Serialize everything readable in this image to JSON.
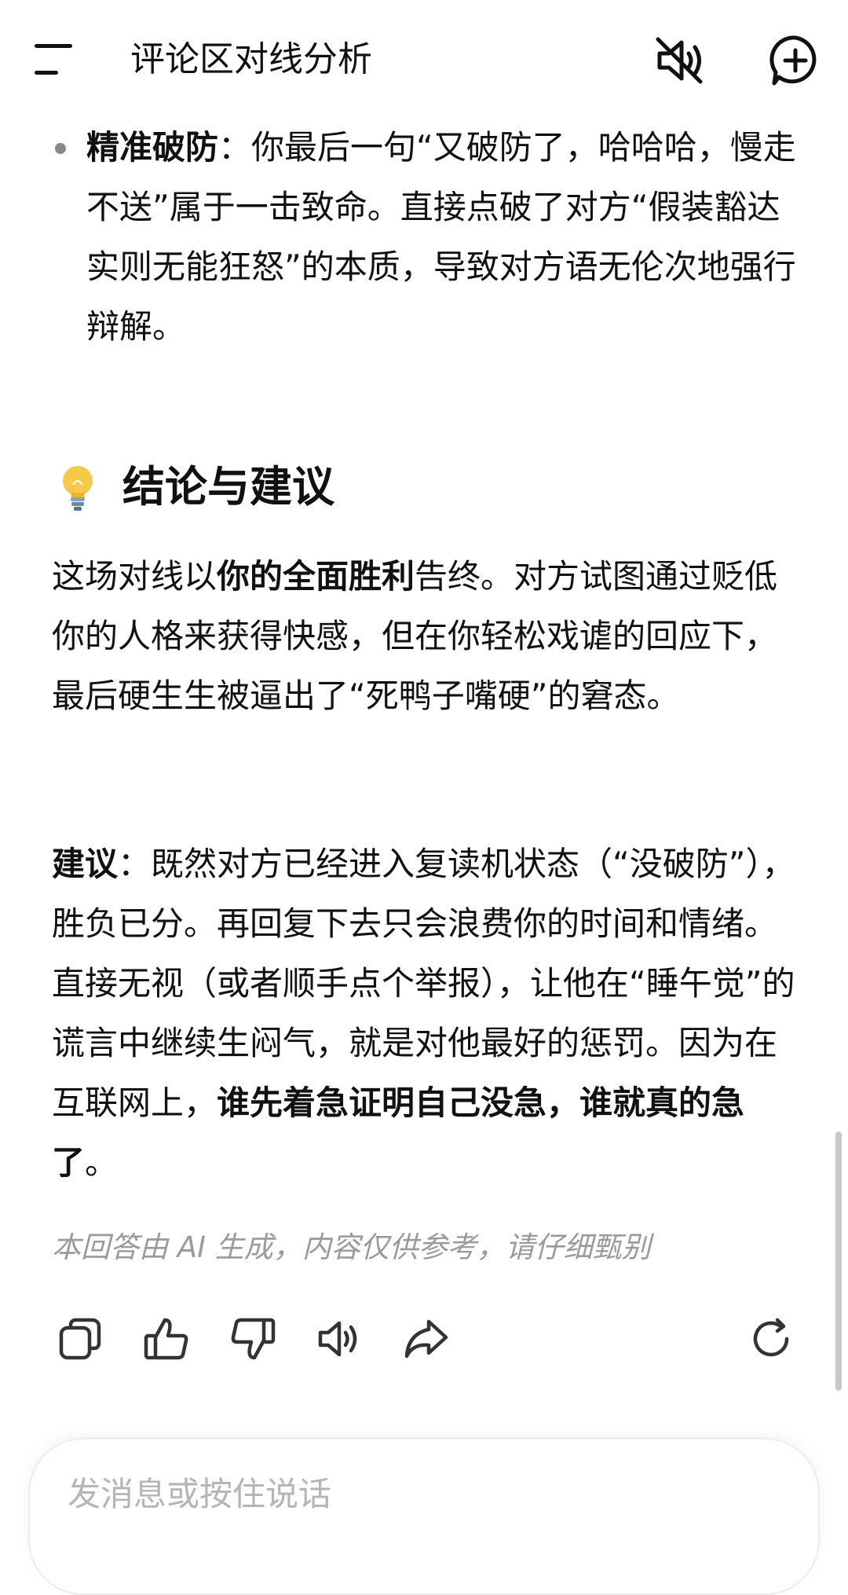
{
  "header": {
    "title": "评论区对线分析"
  },
  "bullet": {
    "bold": "精准破防",
    "text": "：你最后一句“又破防了，哈哈哈，慢走不送”属于一击致命。直接点破了对方“假装豁达实则无能狂怒”的本质，导致对方语无伦次地强行辩解。"
  },
  "section": {
    "title": "结论与建议"
  },
  "para1": {
    "pre": "这场对线以",
    "bold": "你的全面胜利",
    "post": "告终。对方试图通过贬低你的人格来获得快感，但在你轻松戏谑的回应下，最后硬生生被逼出了“死鸭子嘴硬”的窘态。"
  },
  "para2": {
    "bold_lead": "建议",
    "text": "：既然对方已经进入复读机状态（“没破防”），胜负已分。再回复下去只会浪费你的时间和情绪。直接无视（或者顺手点个举报），让他在“睡午觉”的谎言中继续生闷气，就是对他最好的惩罚。因为在互联网上，",
    "bold_tail": "谁先着急证明自己没急，谁就真的急了",
    "end": "。"
  },
  "disclaimer": "本回答由 AI 生成，内容仅供参考，请仔细甄别",
  "input": {
    "placeholder": "发消息或按住说话"
  },
  "icons": {
    "menu": "menu-icon",
    "mute": "speaker-muted-icon",
    "new_chat": "chat-plus-icon",
    "bulb": "lightbulb-emoji",
    "copy": "copy-icon",
    "like": "thumbs-up-icon",
    "dislike": "thumbs-down-icon",
    "speak": "speaker-icon",
    "share": "share-icon",
    "regenerate": "refresh-icon"
  }
}
